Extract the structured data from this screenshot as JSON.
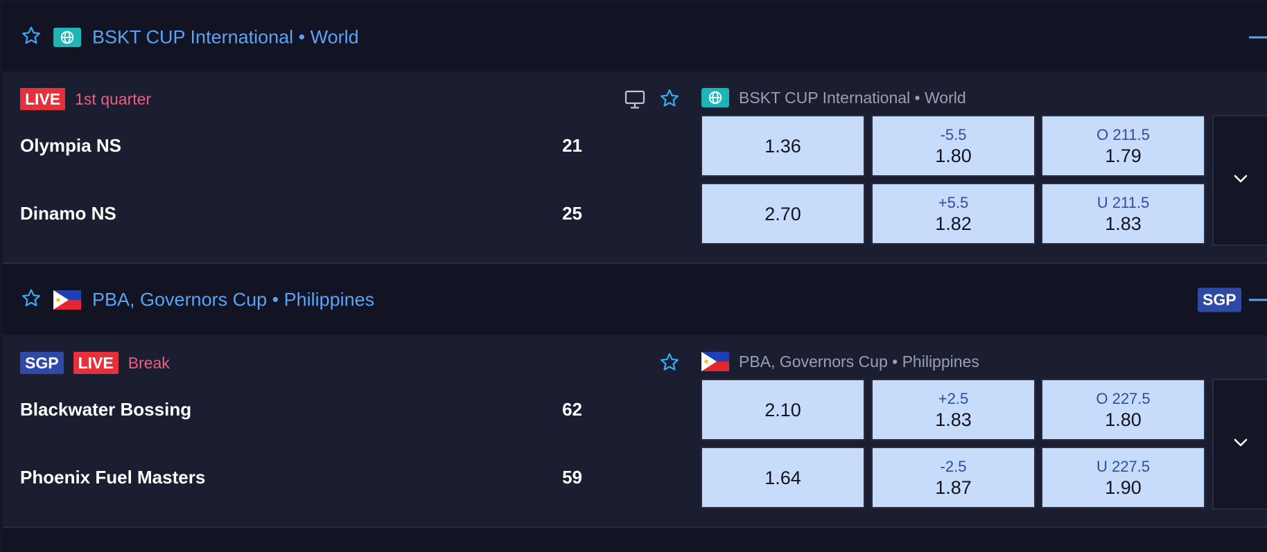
{
  "leagues": [
    {
      "title": "BSKT CUP International • World",
      "icon": "globe-icon",
      "sgp": null,
      "match": {
        "tags": {
          "sgp": null,
          "live": "LIVE"
        },
        "status": "1st quarter",
        "meta_league": "BSKT CUP International • World",
        "teams": [
          {
            "name": "Olympia NS",
            "score": "21",
            "odds": {
              "moneyline": "1.36",
              "spread_line": "-5.5",
              "spread_price": "1.80",
              "total_line": "O 211.5",
              "total_price": "1.79"
            }
          },
          {
            "name": "Dinamo NS",
            "score": "25",
            "odds": {
              "moneyline": "2.70",
              "spread_line": "+5.5",
              "spread_price": "1.82",
              "total_line": "U 211.5",
              "total_price": "1.83"
            }
          }
        ]
      }
    },
    {
      "title": "PBA, Governors Cup • Philippines",
      "icon": "philippines-flag-icon",
      "sgp": "SGP",
      "match": {
        "tags": {
          "sgp": "SGP",
          "live": "LIVE"
        },
        "status": "Break",
        "meta_league": "PBA, Governors Cup • Philippines",
        "teams": [
          {
            "name": "Blackwater Bossing",
            "score": "62",
            "odds": {
              "moneyline": "2.10",
              "spread_line": "+2.5",
              "spread_price": "1.83",
              "total_line": "O 227.5",
              "total_price": "1.80"
            }
          },
          {
            "name": "Phoenix Fuel Masters",
            "score": "59",
            "odds": {
              "moneyline": "1.64",
              "spread_line": "-2.5",
              "spread_price": "1.87",
              "total_line": "U 227.5",
              "total_price": "1.90"
            }
          }
        ]
      }
    }
  ],
  "colors": {
    "accent": "#5aa3f5",
    "live": "#e7313a",
    "status": "#ef5d82",
    "odds_bg": "#c6dcfa",
    "sgp": "#2f4aa6",
    "globe_bg": "#1db5b5"
  }
}
